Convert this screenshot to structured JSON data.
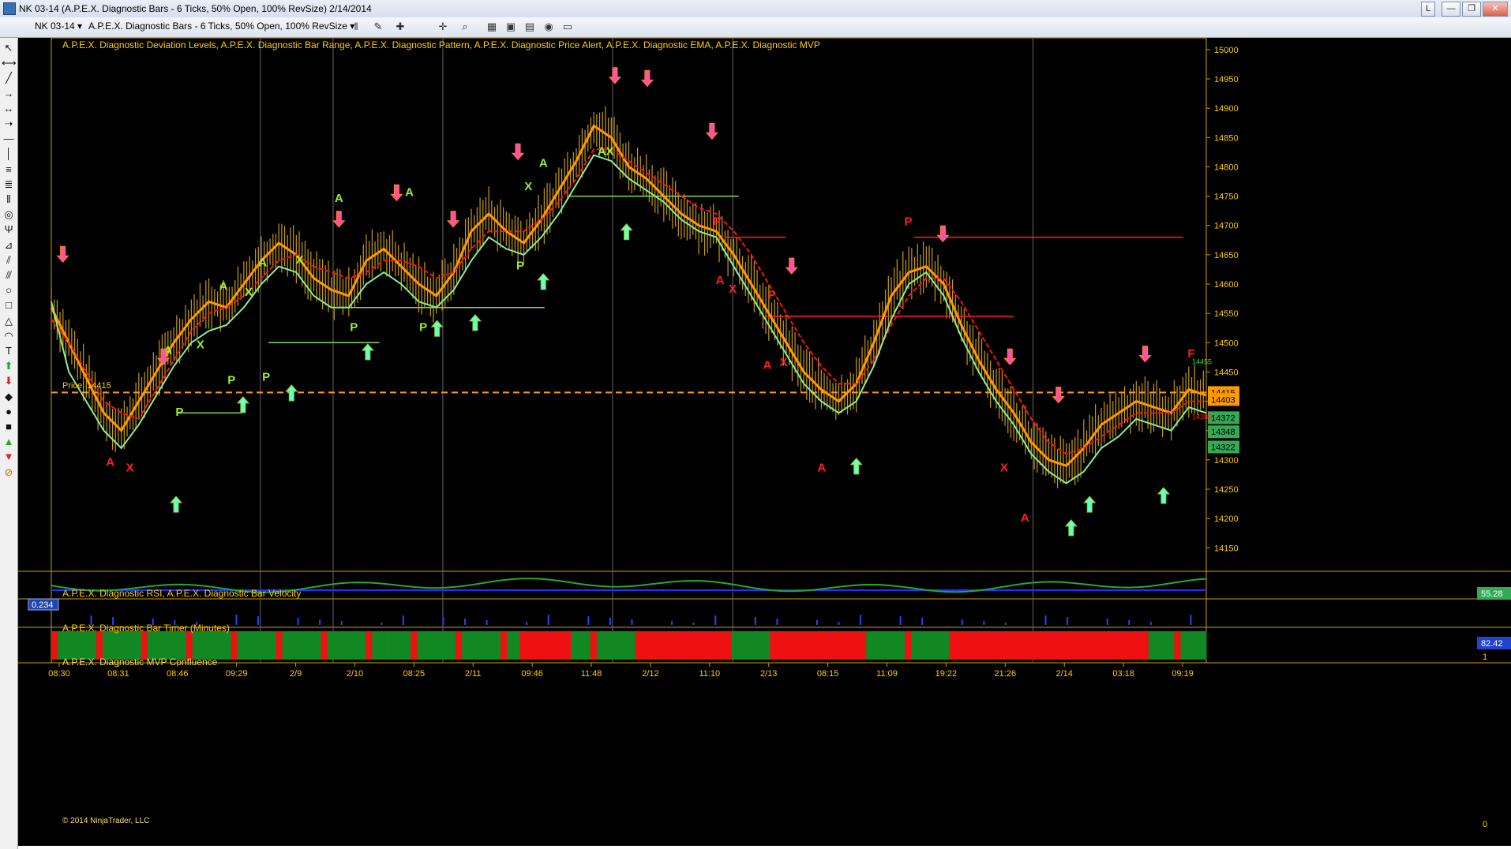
{
  "window": {
    "title": "NK 03-14 (A.P.E.X. Diagnostic Bars - 6 Ticks, 50% Open, 100% RevSize)  2/14/2014",
    "buttons": {
      "l": "L",
      "min": "—",
      "max": "❐",
      "close": "✕"
    }
  },
  "toolbar": {
    "instrument": "NK 03-14  ▾",
    "bar_type": "A.P.E.X. Diagnostic Bars - 6 Ticks, 50% Open, 100% RevSize  ▾",
    "icons": [
      "bars-icon",
      "pencil-icon",
      "marker-icon",
      "crosshair-icon",
      "zoom-icon",
      "strategies-icon",
      "data-box-icon",
      "chart-properties-icon",
      "alert-icon",
      "window-icon"
    ]
  },
  "left_tools": [
    "pointer-icon",
    "ruler-icon",
    "line-icon",
    "ray-icon",
    "extended-line-icon",
    "arrow-line-icon",
    "horizontal-line-icon",
    "vertical-line-icon",
    "fib-retracement-icon",
    "fib-extension-icon",
    "fib-time-icon",
    "fib-circle-icon",
    "andrews-pitchfork-icon",
    "gann-fan-icon",
    "regression-channel-icon",
    "trend-channel-icon",
    "ellipse-icon",
    "rectangle-icon",
    "triangle-icon",
    "arc-icon",
    "text-icon",
    "arrow-up-icon",
    "arrow-down-icon",
    "diamond-icon",
    "dot-icon",
    "square-icon",
    "triangle-up-icon",
    "triangle-down-icon",
    "remove-icon"
  ],
  "panels": {
    "main_label": "A.P.E.X. Diagnostic Deviation Levels, A.P.E.X. Diagnostic Bar Range, A.P.E.X. Diagnostic Pattern, A.P.E.X. Diagnostic Price Alert, A.P.E.X. Diagnostic EMA, A.P.E.X. Diagnostic MVP",
    "rsi_label": "A.P.E.X. Diagnostic RSI, A.P.E.X. Diagnostic Bar Velocity",
    "timer_label": "A.P.E.X. Diagnostic Bar Timer (Minutes)",
    "mvp_label": "A.P.E.X. Diagnostic MVP Confluence",
    "copyright": "© 2014 NinjaTrader, LLC",
    "price_label": "Price:  14415",
    "rsi_left_value": "0.234",
    "rsi_right_value": "55.28",
    "timer_right_value": "82.42",
    "mvp_axis": [
      "1",
      "0"
    ]
  },
  "chart_data": {
    "type": "bar",
    "instrument": "NK 03-14",
    "y_ticks": [
      15000,
      14950,
      14900,
      14850,
      14800,
      14750,
      14700,
      14650,
      14600,
      14550,
      14500,
      14450,
      14400,
      14350,
      14300,
      14250,
      14200,
      14150
    ],
    "ylim": [
      14110,
      15020
    ],
    "x_ticks": [
      "08:30",
      "08:31",
      "08:46",
      "09:29",
      "2/9",
      "2/10",
      "08:25",
      "2/11",
      "09:46",
      "11:48",
      "2/12",
      "11:10",
      "2/13",
      "08:15",
      "11:09",
      "19:22",
      "21:26",
      "2/14",
      "03:18",
      "09:19"
    ],
    "price_tags": [
      {
        "label": "14415",
        "value": 14415,
        "color": "#ff9900"
      },
      {
        "label": "14403",
        "value": 14403,
        "color": "#ff9900"
      },
      {
        "label": "14372",
        "value": 14372,
        "color": "#33aa55"
      },
      {
        "label": "14348",
        "value": 14348,
        "color": "#33aa55"
      },
      {
        "label": "14322",
        "value": 14322,
        "color": "#33aa55"
      }
    ],
    "small_labels": [
      {
        "text": "14455",
        "value": 14455,
        "color": "#33dd33"
      },
      {
        "text": "14380",
        "value": 14380,
        "color": "#ff2222"
      }
    ],
    "current_price": 14415,
    "series": [
      {
        "name": "EMA fast",
        "color": "#ff9900",
        "values": [
          14560,
          14500,
          14440,
          14380,
          14350,
          14400,
          14450,
          14500,
          14540,
          14570,
          14560,
          14600,
          14640,
          14670,
          14650,
          14610,
          14590,
          14580,
          14640,
          14660,
          14630,
          14600,
          14580,
          14620,
          14690,
          14720,
          14690,
          14670,
          14710,
          14760,
          14810,
          14870,
          14850,
          14800,
          14780,
          14750,
          14720,
          14700,
          14690,
          14650,
          14600,
          14550,
          14500,
          14450,
          14420,
          14400,
          14430,
          14500,
          14580,
          14620,
          14630,
          14600,
          14530,
          14470,
          14420,
          14380,
          14330,
          14300,
          14290,
          14320,
          14360,
          14380,
          14400,
          14390,
          14380,
          14420,
          14410
        ]
      },
      {
        "name": "EMA mid",
        "color": "#ff1111",
        "values": [
          14540,
          14500,
          14450,
          14400,
          14380,
          14370,
          14420,
          14470,
          14520,
          14550,
          14560,
          14580,
          14610,
          14640,
          14650,
          14630,
          14620,
          14610,
          14620,
          14640,
          14640,
          14630,
          14610,
          14620,
          14660,
          14690,
          14690,
          14690,
          14710,
          14740,
          14780,
          14830,
          14830,
          14810,
          14790,
          14770,
          14750,
          14730,
          14720,
          14690,
          14650,
          14600,
          14550,
          14500,
          14460,
          14430,
          14430,
          14470,
          14530,
          14580,
          14610,
          14610,
          14570,
          14520,
          14470,
          14420,
          14370,
          14330,
          14310,
          14320,
          14340,
          14360,
          14380,
          14380,
          14380,
          14400,
          14400
        ]
      },
      {
        "name": "Deviation support",
        "color": "#88ee99",
        "values": [
          14570,
          14450,
          14400,
          14350,
          14320,
          14360,
          14410,
          14460,
          14500,
          14520,
          14530,
          14560,
          14600,
          14630,
          14620,
          14580,
          14560,
          14560,
          14600,
          14620,
          14600,
          14570,
          14560,
          14590,
          14640,
          14680,
          14660,
          14650,
          14680,
          14720,
          14770,
          14820,
          14810,
          14780,
          14760,
          14740,
          14710,
          14690,
          14680,
          14630,
          14580,
          14530,
          14480,
          14430,
          14400,
          14380,
          14400,
          14460,
          14540,
          14600,
          14620,
          14580,
          14510,
          14450,
          14400,
          14360,
          14310,
          14280,
          14260,
          14280,
          14320,
          14340,
          14370,
          14360,
          14350,
          14390,
          14380
        ]
      }
    ],
    "signal_labels": [
      {
        "text": "A",
        "color": "#ff2020",
        "x_frac": 0.051,
        "value": 14290
      },
      {
        "text": "X",
        "color": "#ff2020",
        "x_frac": 0.068,
        "value": 14280
      },
      {
        "text": "A",
        "color": "#99ee33",
        "x_frac": 0.101,
        "value": 14480
      },
      {
        "text": "X",
        "color": "#99ee33",
        "x_frac": 0.129,
        "value": 14490
      },
      {
        "text": "A",
        "color": "#99ee33",
        "x_frac": 0.149,
        "value": 14590
      },
      {
        "text": "X",
        "color": "#99ee33",
        "x_frac": 0.171,
        "value": 14580
      },
      {
        "text": "A",
        "color": "#99ee33",
        "x_frac": 0.183,
        "value": 14630
      },
      {
        "text": "X",
        "color": "#99ee33",
        "x_frac": 0.215,
        "value": 14635
      },
      {
        "text": "A",
        "color": "#99ee33",
        "x_frac": 0.249,
        "value": 14740
      },
      {
        "text": "A",
        "color": "#99ee33",
        "x_frac": 0.31,
        "value": 14750
      },
      {
        "text": "X",
        "color": "#99ee33",
        "x_frac": 0.413,
        "value": 14760
      },
      {
        "text": "A",
        "color": "#99ee33",
        "x_frac": 0.426,
        "value": 14800
      },
      {
        "text": "AX",
        "color": "#99ee33",
        "x_frac": 0.48,
        "value": 14820
      },
      {
        "text": "P",
        "color": "#99ee33",
        "x_frac": 0.111,
        "value": 14375
      },
      {
        "text": "P",
        "color": "#99ee33",
        "x_frac": 0.156,
        "value": 14430
      },
      {
        "text": "P",
        "color": "#99ee33",
        "x_frac": 0.186,
        "value": 14435
      },
      {
        "text": "P",
        "color": "#99ee33",
        "x_frac": 0.262,
        "value": 14520
      },
      {
        "text": "P",
        "color": "#99ee33",
        "x_frac": 0.322,
        "value": 14520
      },
      {
        "text": "P",
        "color": "#99ee33",
        "x_frac": 0.406,
        "value": 14625
      },
      {
        "text": "P",
        "color": "#ff2020",
        "x_frac": 0.576,
        "value": 14700
      },
      {
        "text": "A",
        "color": "#ff2020",
        "x_frac": 0.579,
        "value": 14600
      },
      {
        "text": "X",
        "color": "#ff2020",
        "x_frac": 0.59,
        "value": 14585
      },
      {
        "text": "P",
        "color": "#ff2020",
        "x_frac": 0.624,
        "value": 14575
      },
      {
        "text": "A",
        "color": "#ff2020",
        "x_frac": 0.62,
        "value": 14455
      },
      {
        "text": "X",
        "color": "#ff2020",
        "x_frac": 0.634,
        "value": 14460
      },
      {
        "text": "A",
        "color": "#ff2020",
        "x_frac": 0.667,
        "value": 14280
      },
      {
        "text": "P",
        "color": "#ff2020",
        "x_frac": 0.742,
        "value": 14700
      },
      {
        "text": "X",
        "color": "#ff2020",
        "x_frac": 0.825,
        "value": 14280
      },
      {
        "text": "A",
        "color": "#ff2020",
        "x_frac": 0.843,
        "value": 14195
      },
      {
        "text": "F",
        "color": "#ff2020",
        "x_frac": 0.987,
        "value": 14475
      }
    ],
    "alert_arrows": [
      {
        "dir": "down",
        "x_frac": 0.01,
        "value": 14640
      },
      {
        "dir": "down",
        "x_frac": 0.097,
        "value": 14465
      },
      {
        "dir": "down",
        "x_frac": 0.249,
        "value": 14700
      },
      {
        "dir": "down",
        "x_frac": 0.299,
        "value": 14745
      },
      {
        "dir": "down",
        "x_frac": 0.348,
        "value": 14700
      },
      {
        "dir": "down",
        "x_frac": 0.404,
        "value": 14815
      },
      {
        "dir": "down",
        "x_frac": 0.488,
        "value": 14945
      },
      {
        "dir": "down",
        "x_frac": 0.516,
        "value": 14940
      },
      {
        "dir": "down",
        "x_frac": 0.572,
        "value": 14850
      },
      {
        "dir": "down",
        "x_frac": 0.641,
        "value": 14620
      },
      {
        "dir": "down",
        "x_frac": 0.772,
        "value": 14675
      },
      {
        "dir": "down",
        "x_frac": 0.83,
        "value": 14465
      },
      {
        "dir": "down",
        "x_frac": 0.872,
        "value": 14400
      },
      {
        "dir": "down",
        "x_frac": 0.947,
        "value": 14470
      },
      {
        "dir": "up",
        "x_frac": 0.108,
        "value": 14235
      },
      {
        "dir": "up",
        "x_frac": 0.166,
        "value": 14405
      },
      {
        "dir": "up",
        "x_frac": 0.208,
        "value": 14425
      },
      {
        "dir": "up",
        "x_frac": 0.274,
        "value": 14495
      },
      {
        "dir": "up",
        "x_frac": 0.334,
        "value": 14535
      },
      {
        "dir": "up",
        "x_frac": 0.367,
        "value": 14545
      },
      {
        "dir": "up",
        "x_frac": 0.426,
        "value": 14615
      },
      {
        "dir": "up",
        "x_frac": 0.498,
        "value": 14700
      },
      {
        "dir": "up",
        "x_frac": 0.697,
        "value": 14300
      },
      {
        "dir": "up",
        "x_frac": 0.883,
        "value": 14195
      },
      {
        "dir": "up",
        "x_frac": 0.899,
        "value": 14235
      },
      {
        "dir": "up",
        "x_frac": 0.963,
        "value": 14250
      }
    ],
    "levels": [
      {
        "value": 14415,
        "from": 0.0,
        "to": 1.0,
        "color": "#ff9900",
        "style": "dash"
      },
      {
        "value": 14680,
        "from": 0.747,
        "to": 0.98,
        "color": "#ff2020",
        "style": "solid"
      },
      {
        "value": 14545,
        "from": 0.618,
        "to": 0.833,
        "color": "#ff2020",
        "style": "solid"
      },
      {
        "value": 14680,
        "from": 0.583,
        "to": 0.636,
        "color": "#ff2020",
        "style": "solid"
      },
      {
        "value": 14750,
        "from": 0.449,
        "to": 0.595,
        "color": "#88dd44",
        "style": "solid"
      },
      {
        "value": 14500,
        "from": 0.188,
        "to": 0.284,
        "color": "#88dd44",
        "style": "solid"
      },
      {
        "value": 14560,
        "from": 0.251,
        "to": 0.427,
        "color": "#88dd44",
        "style": "solid"
      },
      {
        "value": 14380,
        "from": 0.11,
        "to": 0.165,
        "color": "#88dd44",
        "style": "solid"
      }
    ]
  }
}
